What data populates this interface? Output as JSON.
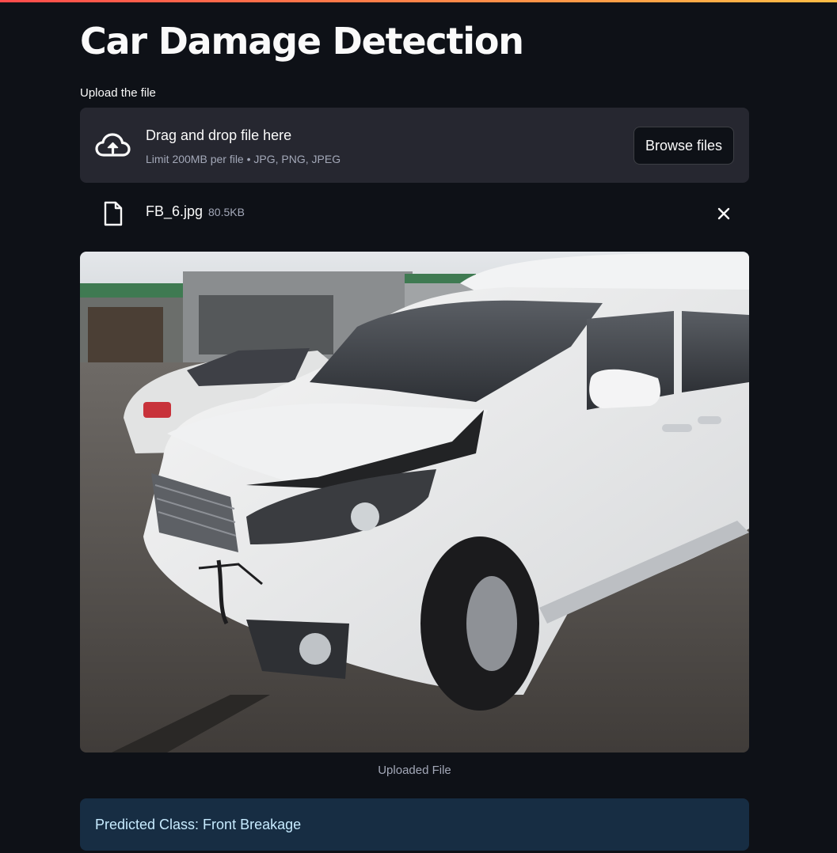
{
  "app": {
    "title": "Car Damage Detection",
    "accent_gradient": [
      "#ff4b4b",
      "#ffbd45"
    ]
  },
  "uploader": {
    "label": "Upload the file",
    "drop_text": "Drag and drop file here",
    "limit_text": "Limit 200MB per file • JPG, PNG, JPEG",
    "browse_label": "Browse files",
    "icon": "cloud-upload-icon"
  },
  "uploaded_file": {
    "name": "FB_6.jpg",
    "size": "80.5KB",
    "icon": "file-icon",
    "remove_icon": "close-icon"
  },
  "image": {
    "caption": "Uploaded File"
  },
  "result": {
    "text": "Predicted Class: Front Breakage",
    "color": "#c7ebff",
    "background": "#172d43"
  }
}
